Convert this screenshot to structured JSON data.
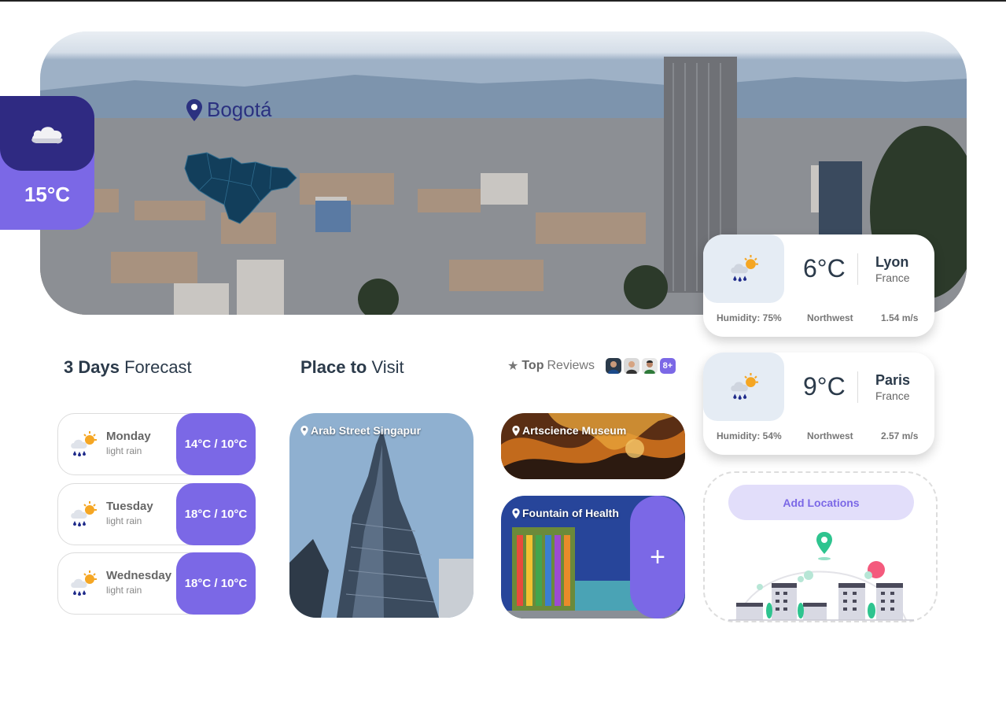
{
  "hero": {
    "city": "Bogotá",
    "current_temp": "15°C",
    "current_icon": "cloud-icon"
  },
  "forecast": {
    "title_bold": "3 Days",
    "title_rest": "Forecast",
    "days": [
      {
        "day": "Monday",
        "desc": "light rain",
        "range": "14°C / 10°C"
      },
      {
        "day": "Tuesday",
        "desc": "light rain",
        "range": "18°C / 10°C"
      },
      {
        "day": "Wednesday",
        "desc": "light rain",
        "range": "18°C / 10°C"
      }
    ]
  },
  "places": {
    "title_bold": "Place to",
    "title_rest": "Visit",
    "items": [
      {
        "name": "Arab Street Singapur"
      },
      {
        "name": "Artscience Museum"
      },
      {
        "name": "Fountain of Health"
      }
    ],
    "add_label": "+"
  },
  "reviews": {
    "star": "★",
    "bold": "Top",
    "rest": "Reviews",
    "more": "8+"
  },
  "locations": [
    {
      "temp": "6°C",
      "city": "Lyon",
      "country": "France",
      "humidity": "Humidity: 75%",
      "direction": "Northwest",
      "wind": "1.54 m/s"
    },
    {
      "temp": "9°C",
      "city": "Paris",
      "country": "France",
      "humidity": "Humidity: 54%",
      "direction": "Northwest",
      "wind": "2.57 m/s"
    }
  ],
  "add_locations": {
    "label": "Add Locations"
  },
  "colors": {
    "accent": "#7b68e6",
    "dark_accent": "#2f2a82",
    "text": "#2b3a4a"
  }
}
